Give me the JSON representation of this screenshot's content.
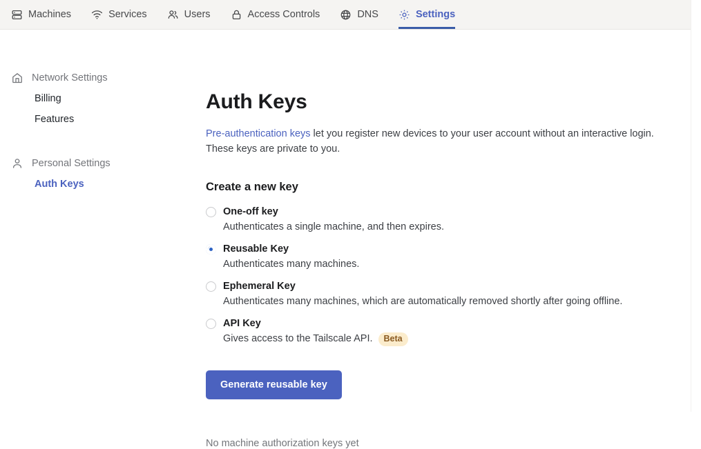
{
  "topnav": {
    "items": [
      {
        "label": "Machines",
        "icon": "server-stack-icon",
        "active": false
      },
      {
        "label": "Services",
        "icon": "wifi-icon",
        "active": false
      },
      {
        "label": "Users",
        "icon": "users-icon",
        "active": false
      },
      {
        "label": "Access Controls",
        "icon": "lock-icon",
        "active": false
      },
      {
        "label": "DNS",
        "icon": "globe-icon",
        "active": false
      },
      {
        "label": "Settings",
        "icon": "gear-icon",
        "active": true
      }
    ],
    "active_color": "#4b62bf",
    "underline_color": "#3a5ca8",
    "background": "#f5f4f2"
  },
  "sidebar": {
    "groups": [
      {
        "heading": "Network Settings",
        "icon": "home-icon",
        "links": [
          {
            "label": "Billing",
            "active": false
          },
          {
            "label": "Features",
            "active": false
          }
        ]
      },
      {
        "heading": "Personal Settings",
        "icon": "person-icon",
        "links": [
          {
            "label": "Auth Keys",
            "active": true
          }
        ]
      }
    ]
  },
  "main": {
    "title": "Auth Keys",
    "intro_link": "Pre-authentication keys",
    "intro_text": " let you register new devices to your user account without an interactive login. These keys are private to you.",
    "section_title": "Create a new key",
    "options": [
      {
        "label": "One-off key",
        "description": "Authenticates a single machine, and then expires.",
        "checked": false,
        "badge": ""
      },
      {
        "label": "Reusable Key",
        "description": "Authenticates many machines.",
        "checked": true,
        "badge": ""
      },
      {
        "label": "Ephemeral Key",
        "description": "Authenticates many machines, which are automatically removed shortly after going offline.",
        "checked": false,
        "badge": ""
      },
      {
        "label": "API Key",
        "description": "Gives access to the Tailscale API.",
        "checked": false,
        "badge": "Beta"
      }
    ],
    "generate_button": "Generate reusable key",
    "empty_state": "No machine authorization keys yet",
    "button_color": "#4b62bf",
    "badge_bg": "#fbeccc",
    "badge_fg": "#8a5a20"
  }
}
